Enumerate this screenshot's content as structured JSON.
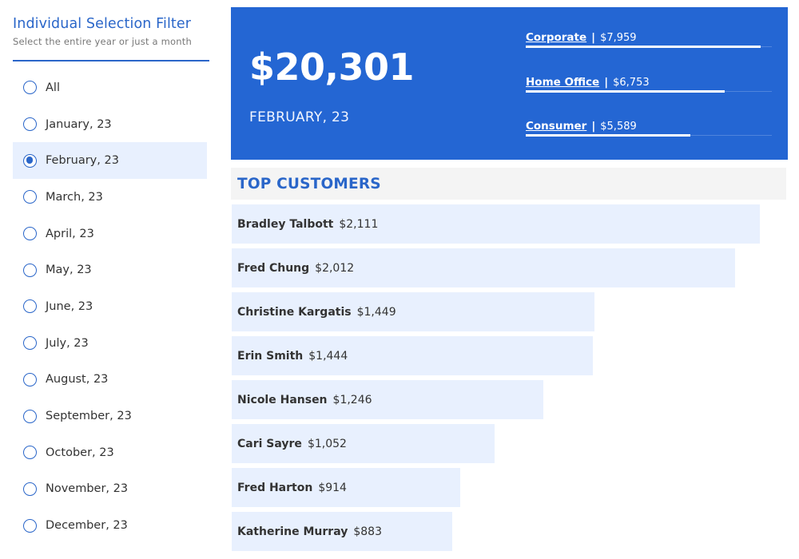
{
  "filter": {
    "title": "Individual Selection Filter",
    "subtitle": "Select the entire year or just a month",
    "selected": "February, 23",
    "options": [
      {
        "label": "All"
      },
      {
        "label": "January, 23"
      },
      {
        "label": "February, 23"
      },
      {
        "label": "March, 23"
      },
      {
        "label": "April, 23"
      },
      {
        "label": "May, 23"
      },
      {
        "label": "June, 23"
      },
      {
        "label": "July, 23"
      },
      {
        "label": "August, 23"
      },
      {
        "label": "September, 23"
      },
      {
        "label": "October, 23"
      },
      {
        "label": "November, 23"
      },
      {
        "label": "December, 23"
      }
    ]
  },
  "kpi": {
    "total": "$20,301",
    "period": "FEBRUARY, 23",
    "segments": [
      {
        "name": "Corporate",
        "value": "$7,959",
        "amount": 7959
      },
      {
        "name": "Home Office",
        "value": "$6,753",
        "amount": 6753
      },
      {
        "name": "Consumer",
        "value": "$5,589",
        "amount": 5589
      }
    ]
  },
  "customers": {
    "title": "TOP CUSTOMERS",
    "items": [
      {
        "name": "Bradley Talbott",
        "value": "$2,111",
        "amount": 2111
      },
      {
        "name": "Fred Chung",
        "value": "$2,012",
        "amount": 2012
      },
      {
        "name": "Christine Kargatis",
        "value": "$1,449",
        "amount": 1449
      },
      {
        "name": "Erin Smith",
        "value": "$1,444",
        "amount": 1444
      },
      {
        "name": "Nicole Hansen",
        "value": "$1,246",
        "amount": 1246
      },
      {
        "name": "Cari Sayre",
        "value": "$1,052",
        "amount": 1052
      },
      {
        "name": "Fred Harton",
        "value": "$914",
        "amount": 914
      },
      {
        "name": "Katherine Murray",
        "value": "$883",
        "amount": 883
      }
    ]
  },
  "colors": {
    "accent": "#2a66c9",
    "kpi_background": "#2466d3",
    "bar": "#e8f0fe"
  }
}
